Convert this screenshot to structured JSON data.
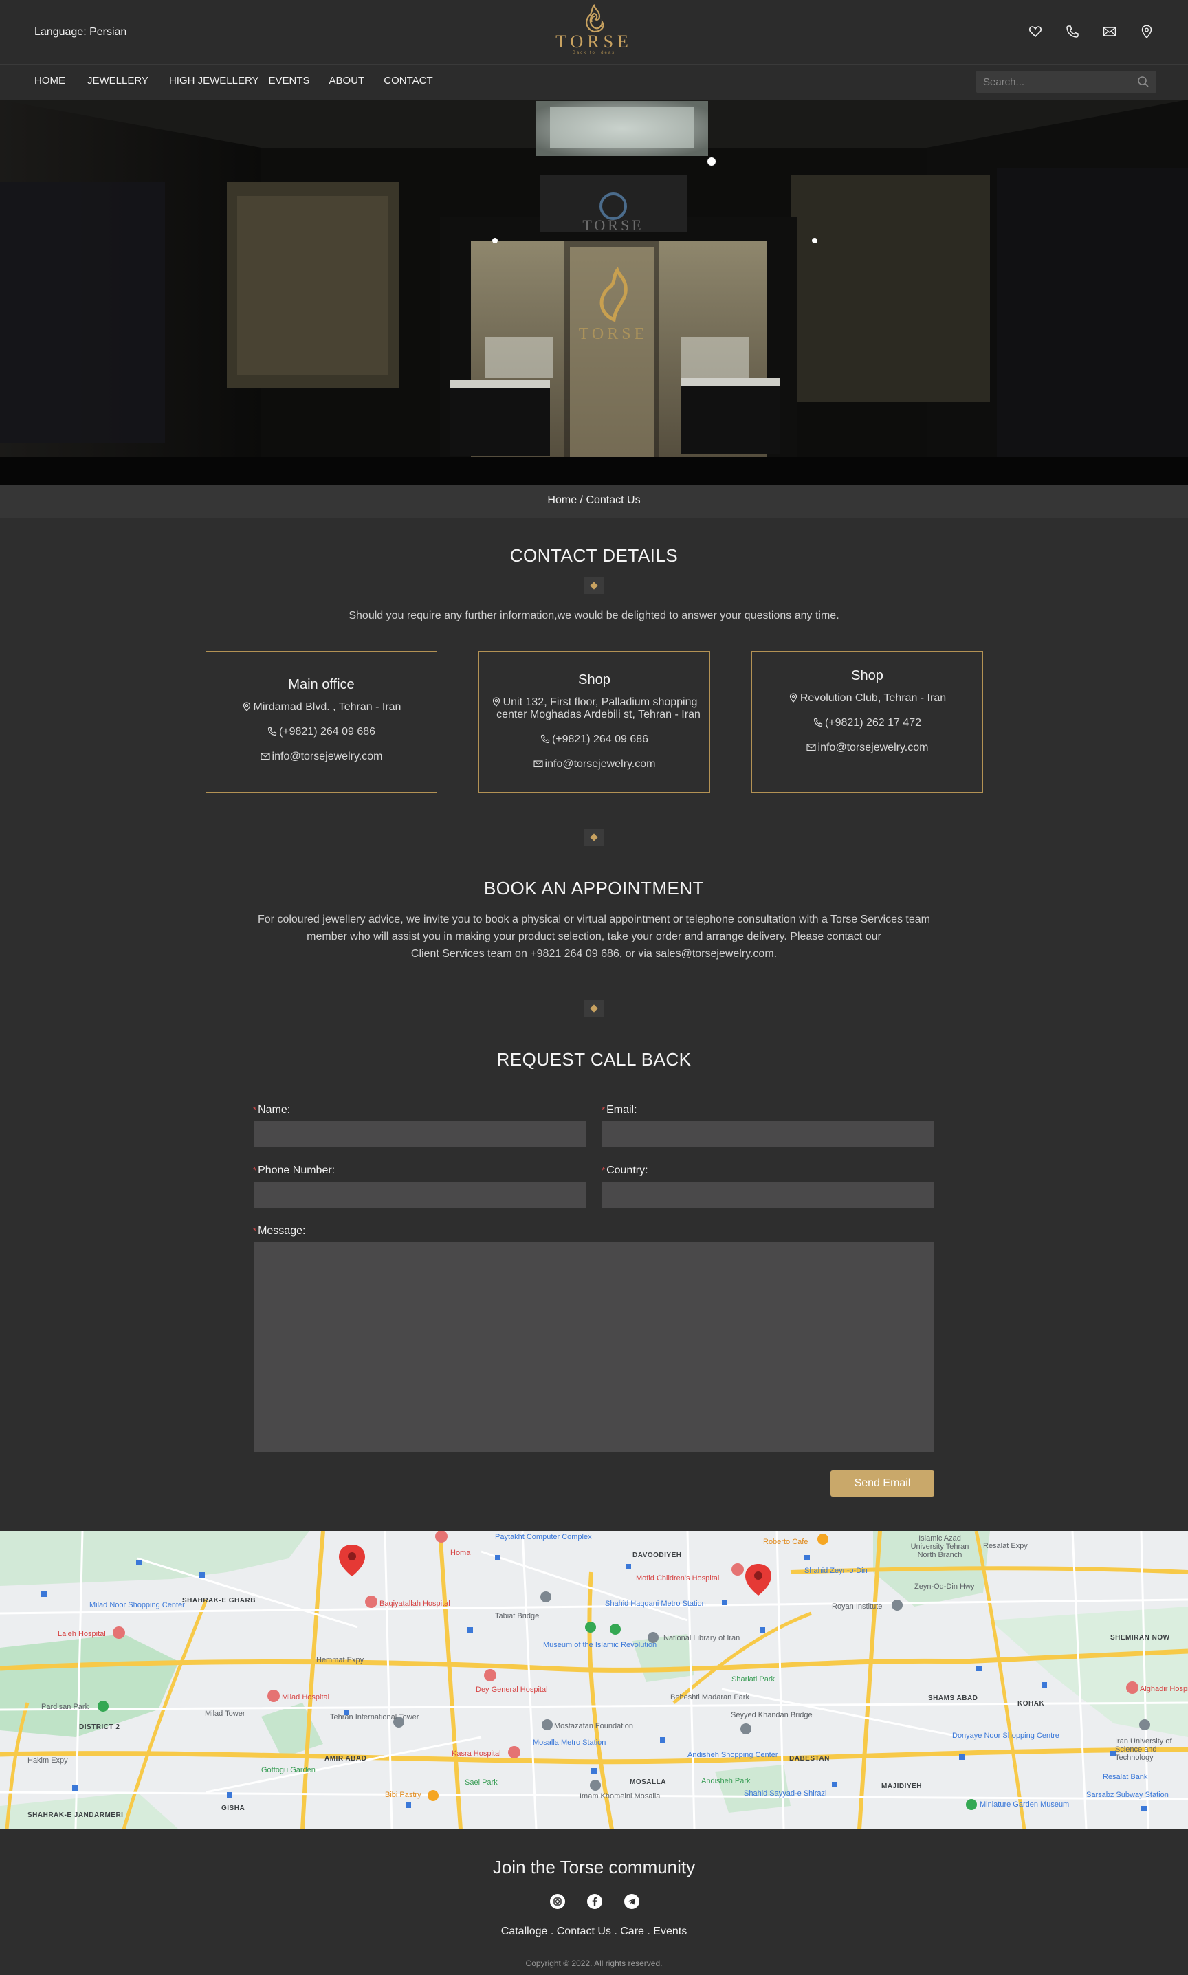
{
  "header": {
    "language_label": "Language: Persian",
    "logo_text": "TORSE",
    "logo_tagline": "Back to Ideas",
    "icons": [
      "heart-icon",
      "phone-icon",
      "mail-icon",
      "location-pin-icon"
    ]
  },
  "nav": {
    "items": [
      "HOME",
      "JEWELLERY",
      "HIGH JEWELLERY",
      "EVENTS",
      "ABOUT",
      "CONTACT"
    ],
    "search_placeholder": "Search..."
  },
  "hero": {
    "store_sign": "TORSE",
    "door_text": "TORSE"
  },
  "breadcrumb": "Home / Contact Us",
  "contact": {
    "title": "CONTACT DETAILS",
    "intro": "Should you require any further information,we would be delighted to answer your questions any time.",
    "cards": [
      {
        "title": "Main office",
        "address": "Mirdamad Blvd. , Tehran - Iran",
        "phone": "(+9821) 264 09 686",
        "email": "info@torsejewelry.com"
      },
      {
        "title": "Shop",
        "address_line1": "Unit 132, First floor, Palladium shopping",
        "address_line2": "center Moghadas Ardebili st, Tehran - Iran",
        "phone": "(+9821) 264 09 686",
        "email": "info@torsejewelry.com"
      },
      {
        "title": "Shop",
        "address": "Revolution Club, Tehran - Iran",
        "phone": "(+9821) 262 17 472",
        "email": "info@torsejewelry.com"
      }
    ]
  },
  "appointment": {
    "title": "BOOK AN APPOINTMENT",
    "line1": "For coloured  jewellery advice, we invite you to book a physical or virtual appointment or telephone consultation with a Torse Services team",
    "line2": "member who will assist you in making your product selection, take your order and arrange delivery. Please contact our",
    "line3": "Client Services team on +9821 264 09 686,  or via sales@torsejewelry.com."
  },
  "callback": {
    "title": "REQUEST CALL BACK",
    "fields": {
      "name": "Name:",
      "email": "Email:",
      "phone": "Phone Number:",
      "country": "Country:",
      "message": "Message:"
    },
    "required_mark": "*",
    "send_label": "Send Email"
  },
  "map": {
    "labels": [
      "DAVOODIYEH",
      "Islamic Azad University Tehran North Branch",
      "Paytakht Computer Complex",
      "Homa",
      "Mofid Children's Hospital",
      "Roberto Cafe",
      "Shahid Zeyn-o-Din",
      "Baqiyatallah Hospital",
      "Milad Noor Shopping Center",
      "Laleh Hospital",
      "SHAHRAK-E GHARB",
      "Tabiat Bridge",
      "Shahid Haqqani Metro Station",
      "Royan Institute",
      "Zeyn-Od-Din Hwy",
      "Hemmat Expy",
      "Museum of the Islamic Revolution",
      "National Library of Iran",
      "SHEMIRAN NOW",
      "Pardisan Park",
      "Milad Tower",
      "Milad Hospital",
      "Dey General Hospital",
      "Shariati Park",
      "Beheshti Madaran Park",
      "Seyyed Khandan Bridge",
      "SHAMS ABAD",
      "KOHAK",
      "Alghadir Hospital",
      "DISTRICT 2",
      "Tehran International Tower",
      "Mostazafan Foundation",
      "Mosalla Metro Station",
      "Donyaye Noor Shopping Centre",
      "Iran University of Science and Technology",
      "Kasra Hospital",
      "Andisheh Shopping Center",
      "DABESTAN",
      "Hakim Expy",
      "AMIR ABAD",
      "Goftogu Garden",
      "Saei Park",
      "MOSALLA",
      "Andisheh Park",
      "MAJIDIYEH",
      "Resalat Bank",
      "Bibi Pastry",
      "Imam Khomeini Mosalla",
      "Shahid Sayyad-e Shirazi",
      "Miniature Garden Museum",
      "Sarsabz Subway Station",
      "SHAHRAK-E JANDARMERI",
      "GISHA",
      "Resalat Expy"
    ]
  },
  "footer": {
    "title": "Join the Torse community",
    "links": [
      "Catalloge",
      "Contact Us",
      "Care",
      "Events"
    ],
    "separator": ".",
    "copyright": "Copyright © 2022. All rights reserved."
  },
  "colors": {
    "gold": "#c8a260",
    "background": "#2e2e2e",
    "input": "#4a494a",
    "button": "#c9a86a"
  }
}
